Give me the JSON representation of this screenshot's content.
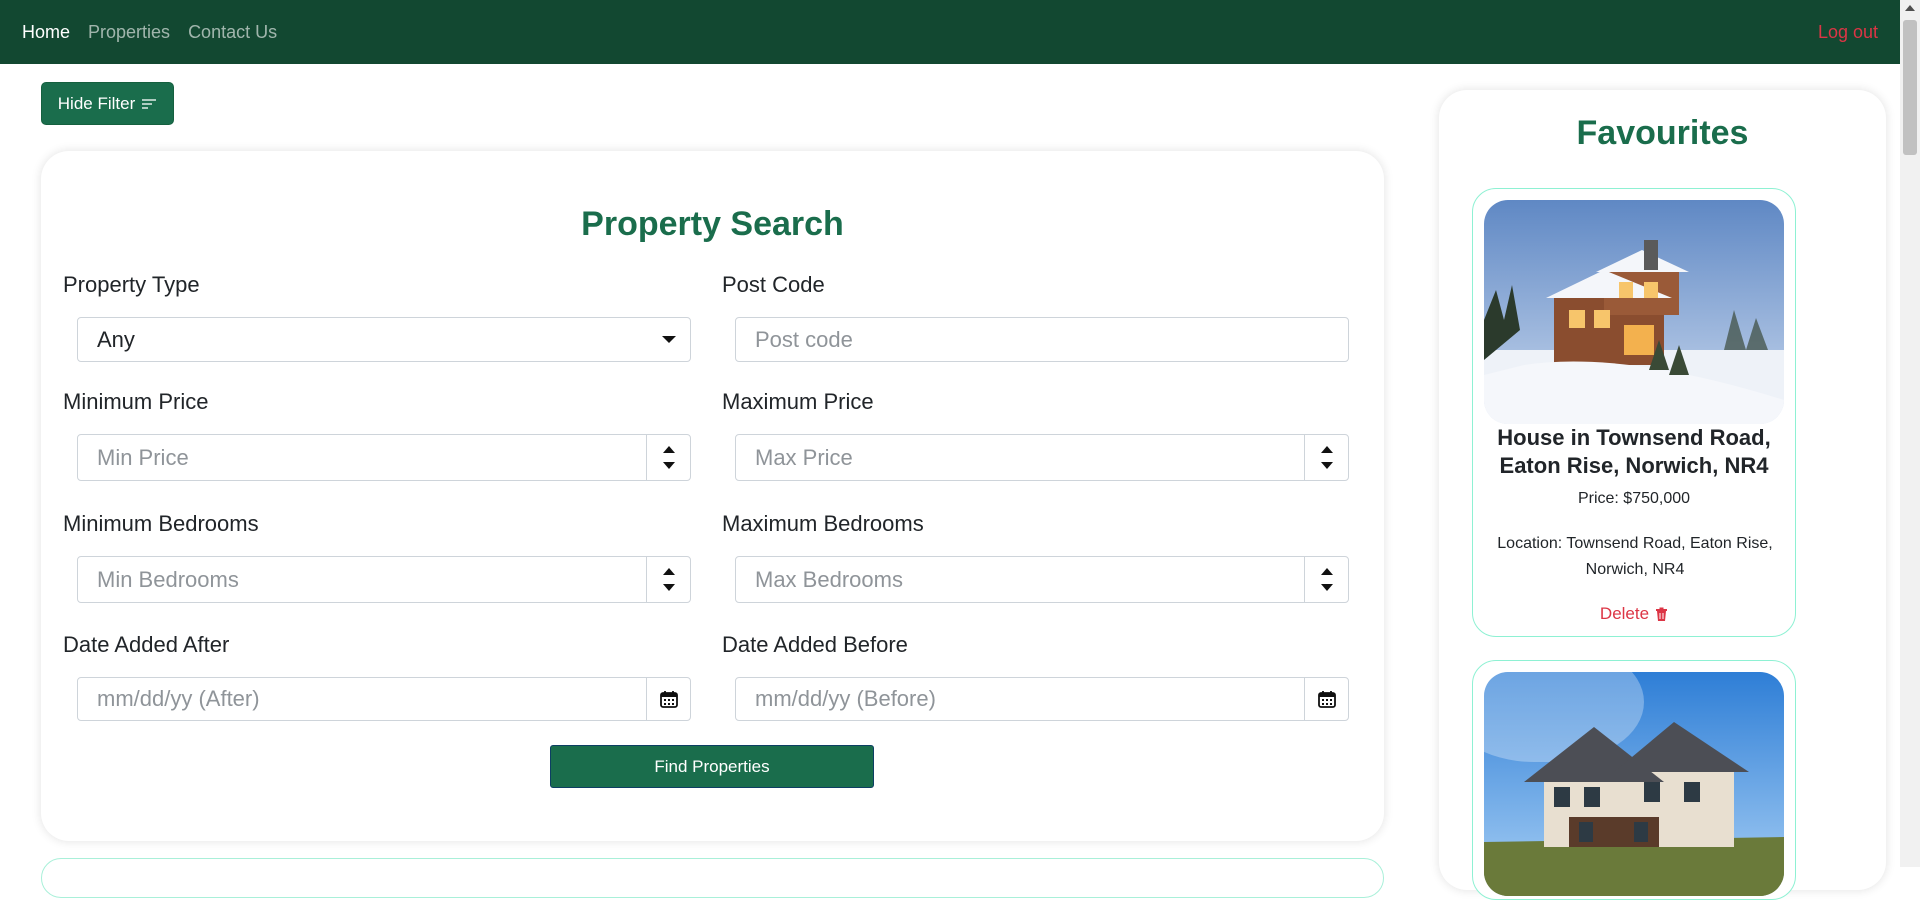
{
  "nav": {
    "home": "Home",
    "properties": "Properties",
    "contact": "Contact Us",
    "logout": "Log out"
  },
  "filter_toggle": {
    "label": "Hide Filter",
    "icon": "filter-lines-icon"
  },
  "search": {
    "title": "Property Search",
    "property_type": {
      "label": "Property Type",
      "value": "Any"
    },
    "post_code": {
      "label": "Post Code",
      "placeholder": "Post code"
    },
    "min_price": {
      "label": "Minimum Price",
      "placeholder": "Min Price"
    },
    "max_price": {
      "label": "Maximum Price",
      "placeholder": "Max Price"
    },
    "min_bedrooms": {
      "label": "Minimum Bedrooms",
      "placeholder": "Min Bedrooms"
    },
    "max_bedrooms": {
      "label": "Maximum Bedrooms",
      "placeholder": "Max Bedrooms"
    },
    "date_after": {
      "label": "Date Added After",
      "placeholder": "mm/dd/yy (After)"
    },
    "date_before": {
      "label": "Date Added Before",
      "placeholder": "mm/dd/yy (Before)"
    },
    "submit": "Find Properties"
  },
  "favourites": {
    "title": "Favourites",
    "items": [
      {
        "name": "House in Townsend Road, Eaton Rise, Norwich, NR4",
        "price": "Price: $750,000",
        "location": "Location: Townsend Road, Eaton Rise, Norwich, NR4",
        "delete_label": "Delete"
      }
    ]
  },
  "colors": {
    "navbar": "#124831",
    "accent": "#1a6d4c",
    "danger": "#dc3545",
    "card_border": "#8ef1d3"
  }
}
